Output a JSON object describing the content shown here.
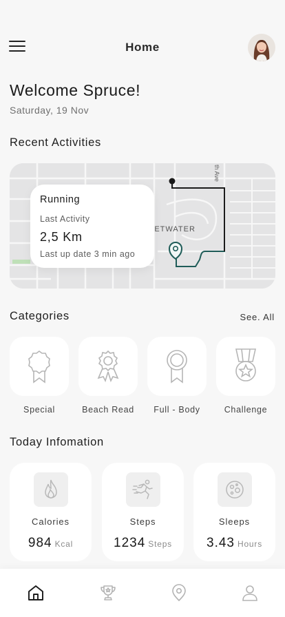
{
  "header": {
    "title": "Home",
    "menu_icon": "hamburger-menu-icon",
    "avatar": "user-avatar"
  },
  "welcome": {
    "title": "Welcome Spruce!",
    "date": "Saturday, 19 Nov"
  },
  "recent": {
    "section_title": "Recent Activities",
    "map": {
      "street_label": "EETWATER",
      "street_label_2": "th Ave",
      "route_color": "#1f5c58"
    },
    "activity": {
      "type": "Running",
      "subtitle": "Last Activity",
      "distance": "2,5 Km",
      "updated": "Last up date 3 min ago"
    }
  },
  "categories": {
    "section_title": "Categories",
    "see_all": "See. All",
    "items": [
      {
        "label": "Special",
        "icon": "medal-ribbon-icon"
      },
      {
        "label": "Beach Read",
        "icon": "badge-ribbon-icon"
      },
      {
        "label": "Full - Body",
        "icon": "award-ribbon-icon"
      },
      {
        "label": "Challenge",
        "icon": "star-medal-icon"
      }
    ]
  },
  "today": {
    "section_title": "Today Infomation",
    "items": [
      {
        "label": "Calories",
        "value": "984",
        "unit": "Kcal",
        "icon": "flame-icon"
      },
      {
        "label": "Steps",
        "value": "1234",
        "unit": "Steps",
        "icon": "running-person-icon"
      },
      {
        "label": "Sleeps",
        "value": "3.43",
        "unit": "Hours",
        "icon": "moon-icon"
      }
    ]
  },
  "tabs": [
    {
      "name": "home",
      "icon": "home-icon",
      "active": true
    },
    {
      "name": "trophy",
      "icon": "trophy-icon",
      "active": false
    },
    {
      "name": "location",
      "icon": "location-pin-icon",
      "active": false
    },
    {
      "name": "profile",
      "icon": "profile-icon",
      "active": false
    }
  ],
  "colors": {
    "background": "#f7f7f7",
    "card": "#ffffff",
    "accent": "#1f5c58",
    "icon_gray": "#b9b9b9"
  }
}
